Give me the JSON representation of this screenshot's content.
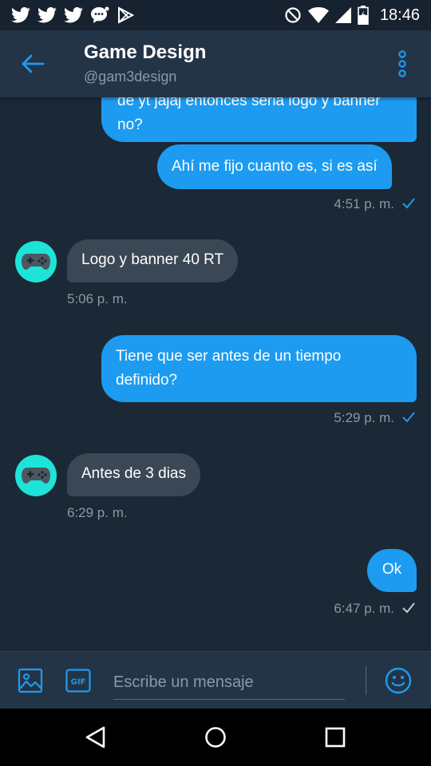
{
  "status_bar": {
    "time": "18:46",
    "left_icons": [
      "twitter-icon",
      "twitter-icon",
      "twitter-icon",
      "message-icon",
      "play-store-icon"
    ],
    "right_icons": [
      "do-not-disturb-icon",
      "wifi-icon",
      "cell-signal-icon",
      "battery-icon"
    ]
  },
  "header": {
    "title": "Game Design",
    "handle": "@gam3design"
  },
  "messages": [
    {
      "dir": "out",
      "text": "de yt jajaj entonces seria logo y banner no?"
    },
    {
      "dir": "out",
      "text": "Ahí me fijo cuanto es, si es así",
      "time": "4:51 p. m.",
      "status": "read"
    },
    {
      "dir": "in",
      "text": "Logo y banner 40 RT",
      "time": "5:06 p. m.",
      "avatar": "gamepad-icon"
    },
    {
      "dir": "out",
      "text": "Tiene que ser antes de un tiempo definido?",
      "time": "5:29 p. m.",
      "status": "read"
    },
    {
      "dir": "in",
      "text": "Antes de 3 dias",
      "time": "6:29 p. m.",
      "avatar": "gamepad-icon"
    },
    {
      "dir": "out",
      "text": "Ok",
      "time": "6:47 p. m.",
      "status": "sent"
    }
  ],
  "composer": {
    "placeholder": "Escribe un mensaje",
    "gif_label": "GIF"
  },
  "colors": {
    "accent": "#1d9bf0",
    "background": "#1b2836",
    "header": "#243447",
    "incoming_bubble": "#3a4754",
    "avatar_bg": "#1ee3d8"
  }
}
